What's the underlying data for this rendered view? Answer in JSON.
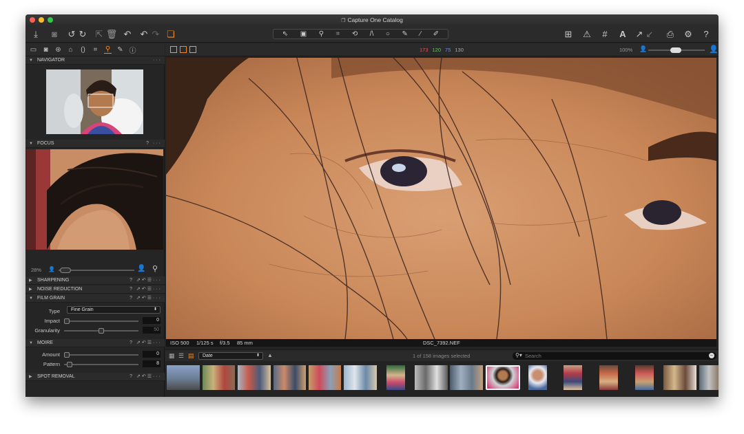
{
  "window": {
    "title": "Capture One Catalog"
  },
  "toolbar": {
    "icons": [
      "import-icon",
      "camera-icon",
      "rotate-left-icon",
      "rotate-right-icon",
      "copy-adjustments-icon",
      "trash-icon",
      "undo-icon",
      "redo-left-icon",
      "redo-right-icon",
      "stack-icon",
      "grid-overlay-icon",
      "exposure-warning-icon",
      "grid-icon",
      "text-icon",
      "export-icon",
      "print-icon",
      "settings-icon",
      "help-icon"
    ],
    "help_glyph": "?"
  },
  "tool_tabs": [
    "folder",
    "camera",
    "color",
    "exposure",
    "lens",
    "crop",
    "details",
    "adjust",
    "metadata"
  ],
  "viewer_bar": {
    "readout_r": "173",
    "readout_g": "120",
    "readout_b": "75",
    "readout_l": "130",
    "zoom": "100%"
  },
  "colors": {
    "accent": "#f08a24",
    "readout_r": "#e05a5a",
    "readout_g": "#6dc46d",
    "readout_b": "#6f8fe8"
  },
  "navigator": {
    "title": "NAVIGATOR"
  },
  "focus": {
    "title": "FOCUS",
    "help": "?",
    "zoom": "28%"
  },
  "sections": {
    "sharpening": "SHARPENING",
    "noise": "NOISE REDUCTION",
    "film_grain": "FILM GRAIN",
    "moire": "MOIRE",
    "spot": "SPOT REMOVAL"
  },
  "film_grain": {
    "type_label": "Type",
    "type_value": "Fine Grain",
    "impact_label": "Impact",
    "impact_value": "0",
    "granularity_label": "Granularity",
    "granularity_value": "50"
  },
  "moire": {
    "amount_label": "Amount",
    "amount_value": "0",
    "pattern_label": "Pattern",
    "pattern_value": "8"
  },
  "info": {
    "iso": "ISO 500",
    "shutter": "1/125 s",
    "aperture": "f/3.5",
    "focal": "85 mm",
    "filename": "DSC_7392.NEF"
  },
  "browser": {
    "sort_value": "Date",
    "selected_count": "1 of 158 images selected",
    "search_placeholder": "Search"
  }
}
